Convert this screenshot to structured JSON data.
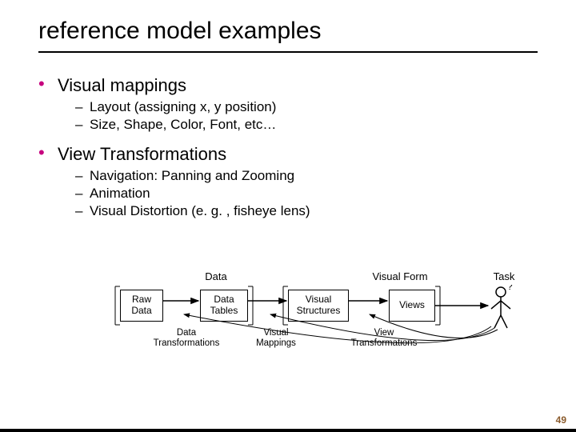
{
  "title": "reference model examples",
  "bullets": {
    "vm": {
      "label": "Visual mappings",
      "sub": {
        "s0": "Layout (assigning x, y position)",
        "s1": "Size, Shape, Color, Font, etc…"
      }
    },
    "vt": {
      "label": "View Transformations",
      "sub": {
        "s0": "Navigation: Panning and Zooming",
        "s1": "Animation",
        "s2": "Visual Distortion (e. g. , fisheye lens)"
      }
    }
  },
  "diagram": {
    "head": {
      "data": "Data",
      "visual_form": "Visual Form",
      "task": "Task"
    },
    "box": {
      "raw": "Raw\nData",
      "tables": "Data\nTables",
      "structs": "Visual\nStructures",
      "views": "Views"
    },
    "below": {
      "dt": "Data\nTransformations",
      "vm": "Visual\nMappings",
      "vt": "View\nTransformations"
    }
  },
  "page_number": "49"
}
